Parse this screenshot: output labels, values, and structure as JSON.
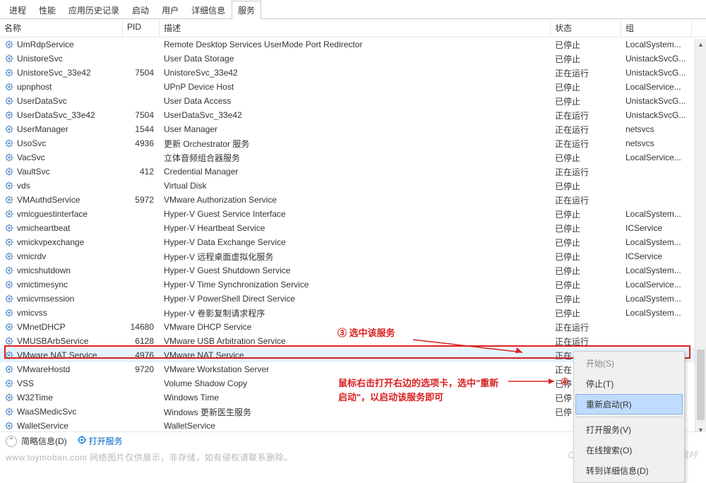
{
  "tabs": {
    "items": [
      {
        "label": "进程"
      },
      {
        "label": "性能"
      },
      {
        "label": "应用历史记录"
      },
      {
        "label": "启动"
      },
      {
        "label": "用户"
      },
      {
        "label": "详细信息"
      },
      {
        "label": "服务"
      }
    ],
    "active_index": 6
  },
  "columns": {
    "name": "名称",
    "pid": "PID",
    "desc": "描述",
    "status": "状态",
    "group": "组"
  },
  "services": [
    {
      "name": "UmRdpService",
      "pid": "",
      "desc": "Remote Desktop Services UserMode Port Redirector",
      "status": "已停止",
      "group": "LocalSystem..."
    },
    {
      "name": "UnistoreSvc",
      "pid": "",
      "desc": "User Data Storage",
      "status": "已停止",
      "group": "UnistackSvcG..."
    },
    {
      "name": "UnistoreSvc_33e42",
      "pid": "7504",
      "desc": "UnistoreSvc_33e42",
      "status": "正在运行",
      "group": "UnistackSvcG..."
    },
    {
      "name": "upnphost",
      "pid": "",
      "desc": "UPnP Device Host",
      "status": "已停止",
      "group": "LocalService..."
    },
    {
      "name": "UserDataSvc",
      "pid": "",
      "desc": "User Data Access",
      "status": "已停止",
      "group": "UnistackSvcG..."
    },
    {
      "name": "UserDataSvc_33e42",
      "pid": "7504",
      "desc": "UserDataSvc_33e42",
      "status": "正在运行",
      "group": "UnistackSvcG..."
    },
    {
      "name": "UserManager",
      "pid": "1544",
      "desc": "User Manager",
      "status": "正在运行",
      "group": "netsvcs"
    },
    {
      "name": "UsoSvc",
      "pid": "4936",
      "desc": "更新 Orchestrator 服务",
      "status": "正在运行",
      "group": "netsvcs"
    },
    {
      "name": "VacSvc",
      "pid": "",
      "desc": "立体音频组合器服务",
      "status": "已停止",
      "group": "LocalService..."
    },
    {
      "name": "VaultSvc",
      "pid": "412",
      "desc": "Credential Manager",
      "status": "正在运行",
      "group": ""
    },
    {
      "name": "vds",
      "pid": "",
      "desc": "Virtual Disk",
      "status": "已停止",
      "group": ""
    },
    {
      "name": "VMAuthdService",
      "pid": "5972",
      "desc": "VMware Authorization Service",
      "status": "正在运行",
      "group": ""
    },
    {
      "name": "vmicguestinterface",
      "pid": "",
      "desc": "Hyper-V Guest Service Interface",
      "status": "已停止",
      "group": "LocalSystem..."
    },
    {
      "name": "vmicheartbeat",
      "pid": "",
      "desc": "Hyper-V Heartbeat Service",
      "status": "已停止",
      "group": "ICService"
    },
    {
      "name": "vmickvpexchange",
      "pid": "",
      "desc": "Hyper-V Data Exchange Service",
      "status": "已停止",
      "group": "LocalSystem..."
    },
    {
      "name": "vmicrdv",
      "pid": "",
      "desc": "Hyper-V 远程桌面虚拟化服务",
      "status": "已停止",
      "group": "ICService"
    },
    {
      "name": "vmicshutdown",
      "pid": "",
      "desc": "Hyper-V Guest Shutdown Service",
      "status": "已停止",
      "group": "LocalSystem..."
    },
    {
      "name": "vmictimesync",
      "pid": "",
      "desc": "Hyper-V Time Synchronization Service",
      "status": "已停止",
      "group": "LocalService..."
    },
    {
      "name": "vmicvmsession",
      "pid": "",
      "desc": "Hyper-V PowerShell Direct Service",
      "status": "已停止",
      "group": "LocalSystem..."
    },
    {
      "name": "vmicvss",
      "pid": "",
      "desc": "Hyper-V 卷影复制请求程序",
      "status": "已停止",
      "group": "LocalSystem..."
    },
    {
      "name": "VMnetDHCP",
      "pid": "14680",
      "desc": "VMware DHCP Service",
      "status": "正在运行",
      "group": ""
    },
    {
      "name": "VMUSBArbService",
      "pid": "6128",
      "desc": "VMware USB Arbitration Service",
      "status": "正在运行",
      "group": ""
    },
    {
      "name": "VMware NAT Service",
      "pid": "4976",
      "desc": "VMware NAT Service",
      "status": "正在",
      "group": ""
    },
    {
      "name": "VMwareHostd",
      "pid": "9720",
      "desc": "VMware Workstation Server",
      "status": "正在",
      "group": ""
    },
    {
      "name": "VSS",
      "pid": "",
      "desc": "Volume Shadow Copy",
      "status": "已停",
      "group": ""
    },
    {
      "name": "W32Time",
      "pid": "",
      "desc": "Windows Time",
      "status": "已停",
      "group": ""
    },
    {
      "name": "WaaSMedicSvc",
      "pid": "",
      "desc": "Windows 更新医生服务",
      "status": "已停",
      "group": ""
    },
    {
      "name": "WalletService",
      "pid": "",
      "desc": "WalletService",
      "status": "",
      "group": ""
    }
  ],
  "selected_index": 22,
  "context_menu": {
    "items": [
      {
        "label": "开始(S)",
        "disabled": true
      },
      {
        "label": "停止(T)",
        "disabled": false
      },
      {
        "label": "重新启动(R)",
        "disabled": false,
        "hl": true
      },
      {
        "sep": true
      },
      {
        "label": "打开服务(V)",
        "disabled": false
      },
      {
        "label": "在线搜索(O)",
        "disabled": false
      },
      {
        "label": "转到详细信息(D)",
        "disabled": false
      }
    ]
  },
  "annotations": {
    "select_service": "③ 选中该服务",
    "right_click": "鼠标右击打开右边的选项卡，选中\"重新启动\"，以启动该服务即可",
    "circle4": "④"
  },
  "footer": {
    "brief": "简略信息(D)",
    "open_services": "打开服务"
  },
  "watermarks": {
    "bottom": "www.toymoban.com 网络图片仅供展示，非存储，如有侵权请联系删除。",
    "right": "CSDN @陌上少年，且听这风吟"
  }
}
